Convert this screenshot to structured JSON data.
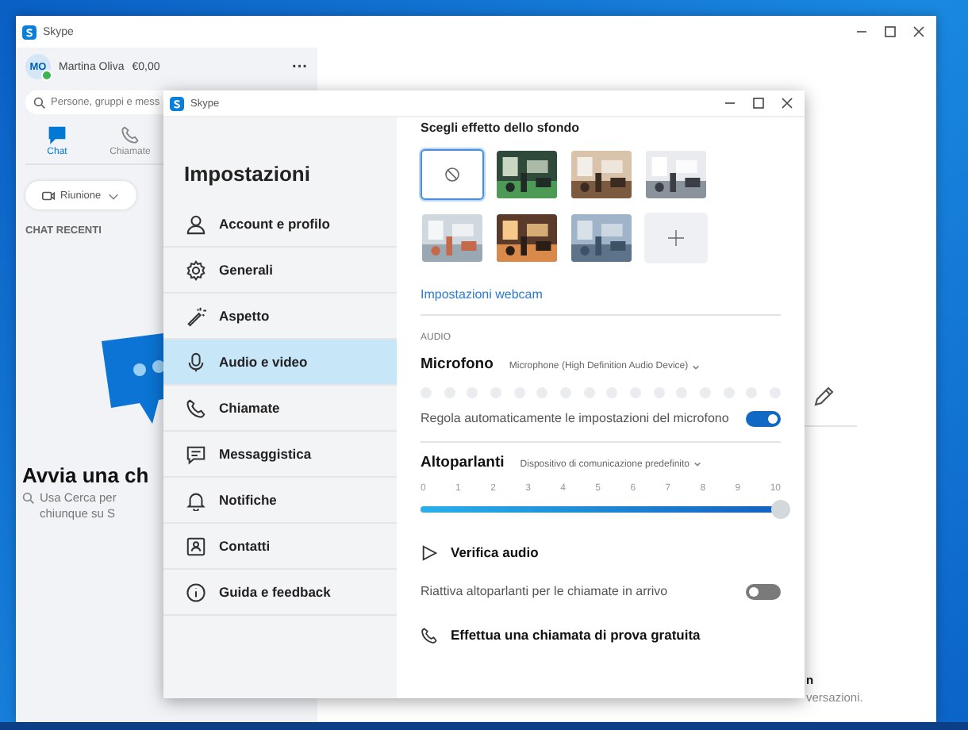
{
  "main_window": {
    "title": "Skype",
    "profile": {
      "initials": "MO",
      "name": "Martina Oliva",
      "credit": "€0,00",
      "online": true
    },
    "more": "···",
    "search": {
      "placeholder": "Persone, gruppi e mess"
    },
    "tabs": [
      {
        "label": "Chat",
        "selected": true
      },
      {
        "label": "Chiamate",
        "selected": false
      }
    ],
    "meeting_button": "Riunione",
    "recent_header": "CHAT RECENTI",
    "start_chat": {
      "title": "Avvia una ch",
      "lines": [
        "Usa Cerca per",
        "chiunque su S"
      ]
    },
    "conversation_fragments": [
      "n",
      "versazioni."
    ]
  },
  "settings": {
    "title": "Skype",
    "heading": "Impostazioni",
    "nav": [
      {
        "label": "Account e profilo",
        "selected": false
      },
      {
        "label": "Generali",
        "selected": false
      },
      {
        "label": "Aspetto",
        "selected": false
      },
      {
        "label": "Audio e video",
        "selected": true
      },
      {
        "label": "Chiamate",
        "selected": false
      },
      {
        "label": "Messaggistica",
        "selected": false
      },
      {
        "label": "Notifiche",
        "selected": false
      },
      {
        "label": "Contatti",
        "selected": false
      },
      {
        "label": "Guida e feedback",
        "selected": false
      }
    ],
    "background": {
      "title": "Scegli effetto dello sfondo",
      "tiles": [
        {
          "kind": "none",
          "selected": true
        },
        {
          "kind": "picture",
          "selected": false
        },
        {
          "kind": "picture",
          "selected": false
        },
        {
          "kind": "picture",
          "selected": false
        },
        {
          "kind": "picture",
          "selected": false
        },
        {
          "kind": "picture",
          "selected": false
        },
        {
          "kind": "picture",
          "selected": false
        },
        {
          "kind": "add",
          "selected": false
        }
      ]
    },
    "webcam_link": "Impostazioni webcam",
    "audio": {
      "section": "AUDIO",
      "microphone": {
        "label": "Microfono",
        "device": "Microphone (High Definition Audio Device)"
      },
      "auto_adjust": {
        "label": "Regola automaticamente le impostazioni del microfono",
        "on": true
      },
      "speakers": {
        "label": "Altoparlanti",
        "device": "Dispositivo di comunicazione predefinito",
        "ticks": [
          "0",
          "1",
          "2",
          "3",
          "4",
          "5",
          "6",
          "7",
          "8",
          "9",
          "10"
        ],
        "level": 1
      },
      "test_audio": "Verifica audio",
      "unmute": {
        "label": "Riattiva altoparlanti per le chiamate in arrivo",
        "on": false
      },
      "test_call": "Effettua una chiamata di prova gratuita"
    }
  }
}
